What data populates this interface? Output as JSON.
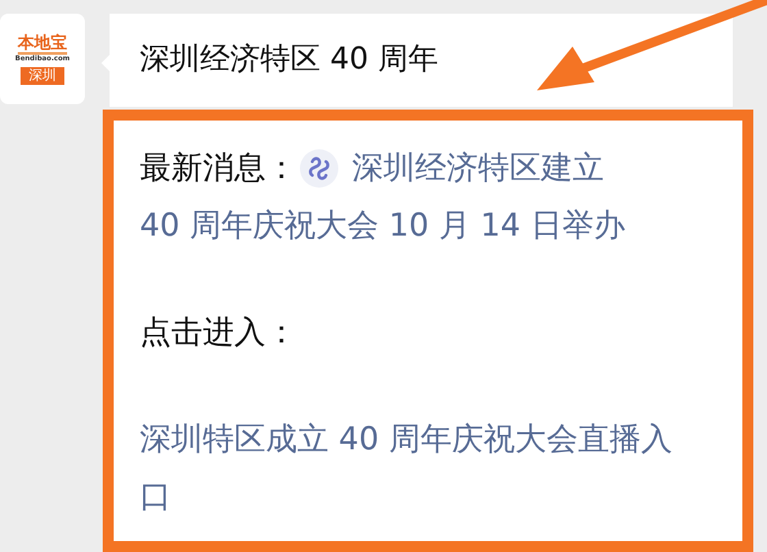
{
  "avatar": {
    "logo_text": "本地宝",
    "site": "Bendibao.com",
    "city": "深圳"
  },
  "message": {
    "title": "深圳经济特区 40 周年",
    "news_label": "最新消息：",
    "news_link_lines": [
      "深圳经济特区建立",
      "40 周年庆祝大会 10 月 14 日举办"
    ],
    "enter_label": "点击进入：",
    "live_link": "深圳特区成立 40 周年庆祝大会直播入口"
  }
}
